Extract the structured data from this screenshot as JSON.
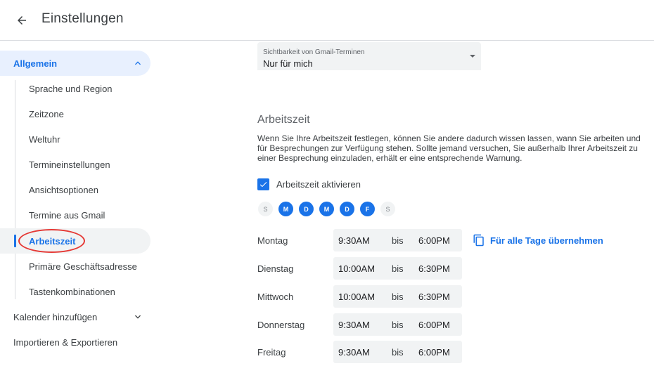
{
  "header": {
    "title": "Einstellungen"
  },
  "sidebar": {
    "general": "Allgemein",
    "sub_items": [
      "Sprache und Region",
      "Zeitzone",
      "Weltuhr",
      "Termineinstellungen",
      "Ansichtsoptionen",
      "Termine aus Gmail",
      "Arbeitszeit",
      "Primäre Geschäftsadresse",
      "Tastenkombinationen"
    ],
    "add_calendar": "Kalender hinzufügen",
    "import_export": "Importieren & Exportieren"
  },
  "visibility": {
    "label": "Sichtbarkeit von Gmail-Terminen",
    "value": "Nur für mich"
  },
  "working_hours": {
    "title": "Arbeitszeit",
    "description": "Wenn Sie Ihre Arbeitszeit festlegen, können Sie andere dadurch wissen lassen, wann Sie arbeiten und für Besprechungen zur Verfügung stehen. Sollte jemand versuchen, Sie außerhalb Ihrer Arbeitszeit zu einer Besprechung einzuladen, erhält er eine entsprechende Warnung.",
    "enable_label": "Arbeitszeit aktivieren",
    "enabled": true,
    "days": [
      {
        "letter": "S",
        "active": false
      },
      {
        "letter": "M",
        "active": true
      },
      {
        "letter": "D",
        "active": true
      },
      {
        "letter": "M",
        "active": true
      },
      {
        "letter": "D",
        "active": true
      },
      {
        "letter": "F",
        "active": true
      },
      {
        "letter": "S",
        "active": false
      }
    ],
    "to_label": "bis",
    "apply_all_label": "Für alle Tage übernehmen",
    "schedule": [
      {
        "day": "Montag",
        "start": "9:30AM",
        "end": "6:00PM"
      },
      {
        "day": "Dienstag",
        "start": "10:00AM",
        "end": "6:30PM"
      },
      {
        "day": "Mittwoch",
        "start": "10:00AM",
        "end": "6:30PM"
      },
      {
        "day": "Donnerstag",
        "start": "9:30AM",
        "end": "6:00PM"
      },
      {
        "day": "Freitag",
        "start": "9:30AM",
        "end": "6:00PM"
      }
    ]
  },
  "colors": {
    "accent": "#1a73e8",
    "annotation": "#e53935",
    "field_bg": "#f1f3f4"
  },
  "icons": {
    "back": "arrow-back-icon",
    "expand": "chevron-up-icon",
    "collapse": "chevron-down-icon",
    "check": "check-icon",
    "copy": "copy-icon"
  }
}
